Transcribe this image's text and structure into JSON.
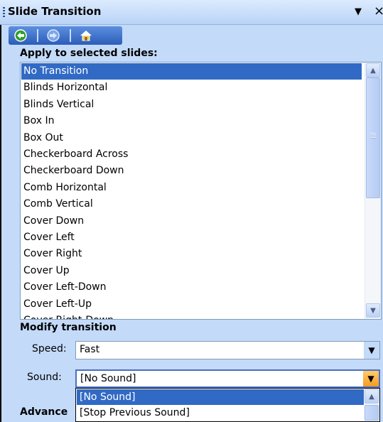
{
  "panel": {
    "title": "Slide Transition",
    "dropdown_icon": "chevron-down-icon",
    "close_label": "×"
  },
  "nav": {
    "back_icon": "back-arrow-icon",
    "forward_icon": "forward-arrow-icon",
    "home_icon": "home-icon"
  },
  "apply_section": {
    "label": "Apply to selected slides:",
    "selected": "No Transition",
    "items": [
      "No Transition",
      "Blinds Horizontal",
      "Blinds Vertical",
      "Box In",
      "Box Out",
      "Checkerboard Across",
      "Checkerboard Down",
      "Comb Horizontal",
      "Comb Vertical",
      "Cover Down",
      "Cover Left",
      "Cover Right",
      "Cover Up",
      "Cover Left-Down",
      "Cover Left-Up",
      "Cover Right-Down"
    ]
  },
  "modify_section": {
    "label": "Modify transition",
    "speed_label": "Speed:",
    "speed_value": "Fast",
    "sound_label": "Sound:",
    "sound_value": "[No Sound]",
    "sound_options": [
      "[No Sound]",
      "[Stop Previous Sound]"
    ],
    "sound_selected": "[No Sound]"
  },
  "advanced_label": "Advance",
  "colors": {
    "selection": "#316ac5",
    "panel_bg": "#c3daf9",
    "nav_bar": "#2c5db8",
    "active_dropdown_button": "#f59b22"
  }
}
